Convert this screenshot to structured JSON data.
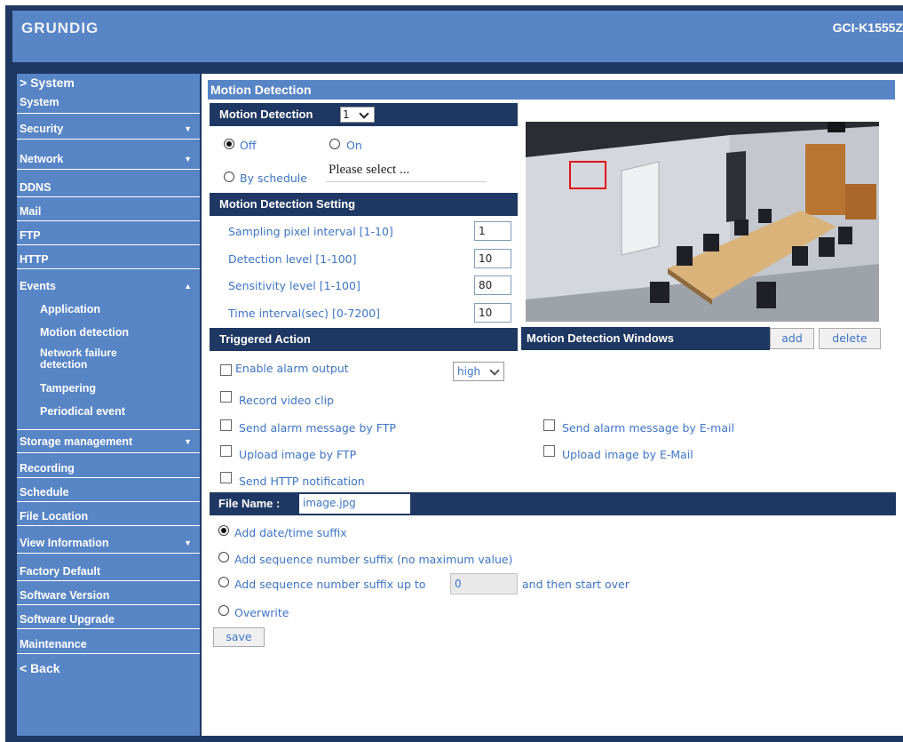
{
  "header": {
    "logo": "GRUNDIG",
    "model": "GCI-K1555Z"
  },
  "sidebar": {
    "heading": "> System",
    "items": {
      "system": "System",
      "security": "Security",
      "network": "Network",
      "ddns": "DDNS",
      "mail": "Mail",
      "ftp": "FTP",
      "http": "HTTP",
      "events": "Events",
      "application": "Application",
      "motion_detection": "Motion detection",
      "network_failure": "Network failure detection",
      "tampering": "Tampering",
      "periodical_event": "Periodical event",
      "storage_management": "Storage management",
      "recording": "Recording",
      "schedule": "Schedule",
      "file_location": "File Location",
      "view_information": "View Information",
      "factory_default": "Factory Default",
      "software_version": "Software Version",
      "software_upgrade": "Software Upgrade",
      "maintenance": "Maintenance"
    },
    "back": "< Back"
  },
  "page": {
    "title": "Motion Detection"
  },
  "motion": {
    "header": "Motion Detection",
    "number_value": "1",
    "off_label": "Off",
    "on_label": "On",
    "schedule_label": "By schedule",
    "schedule_select": "Please select ...",
    "selected_mode": "off"
  },
  "settings": {
    "header": "Motion Detection Setting",
    "sampling_label": "Sampling pixel interval [1-10]",
    "sampling_value": "1",
    "detection_label": "Detection level [1-100]",
    "detection_value": "10",
    "sensitivity_label": "Sensitivity level [1-100]",
    "sensitivity_value": "80",
    "interval_label": "Time interval(sec) [0-7200]",
    "interval_value": "10"
  },
  "windows": {
    "label": "Motion Detection Windows",
    "add": "add",
    "delete": "delete"
  },
  "triggered": {
    "header": "Triggered Action",
    "alarm_output": "Enable alarm output",
    "alarm_level": "high",
    "record_clip": "Record video clip",
    "send_ftp": "Send alarm message by FTP",
    "send_email": "Send alarm message by E-mail",
    "upload_ftp": "Upload image by FTP",
    "upload_email": "Upload image by E-Mail",
    "send_http": "Send HTTP notification"
  },
  "file": {
    "header": "File Name :",
    "name_value": "image.jpg",
    "opt_datetime": "Add date/time suffix",
    "opt_seq_nomax": "Add sequence number suffix (no maximum value)",
    "opt_seq_upto": "Add sequence number suffix up to",
    "seq_value": "0",
    "opt_seq_after": "and then start over",
    "opt_overwrite": "Overwrite",
    "selected": "datetime"
  },
  "actions": {
    "save": "save"
  },
  "colors": {
    "navy": "#1f3863",
    "blue": "#5885c6",
    "label_blue": "#3f74c6",
    "motion_window": "#e0141a"
  }
}
